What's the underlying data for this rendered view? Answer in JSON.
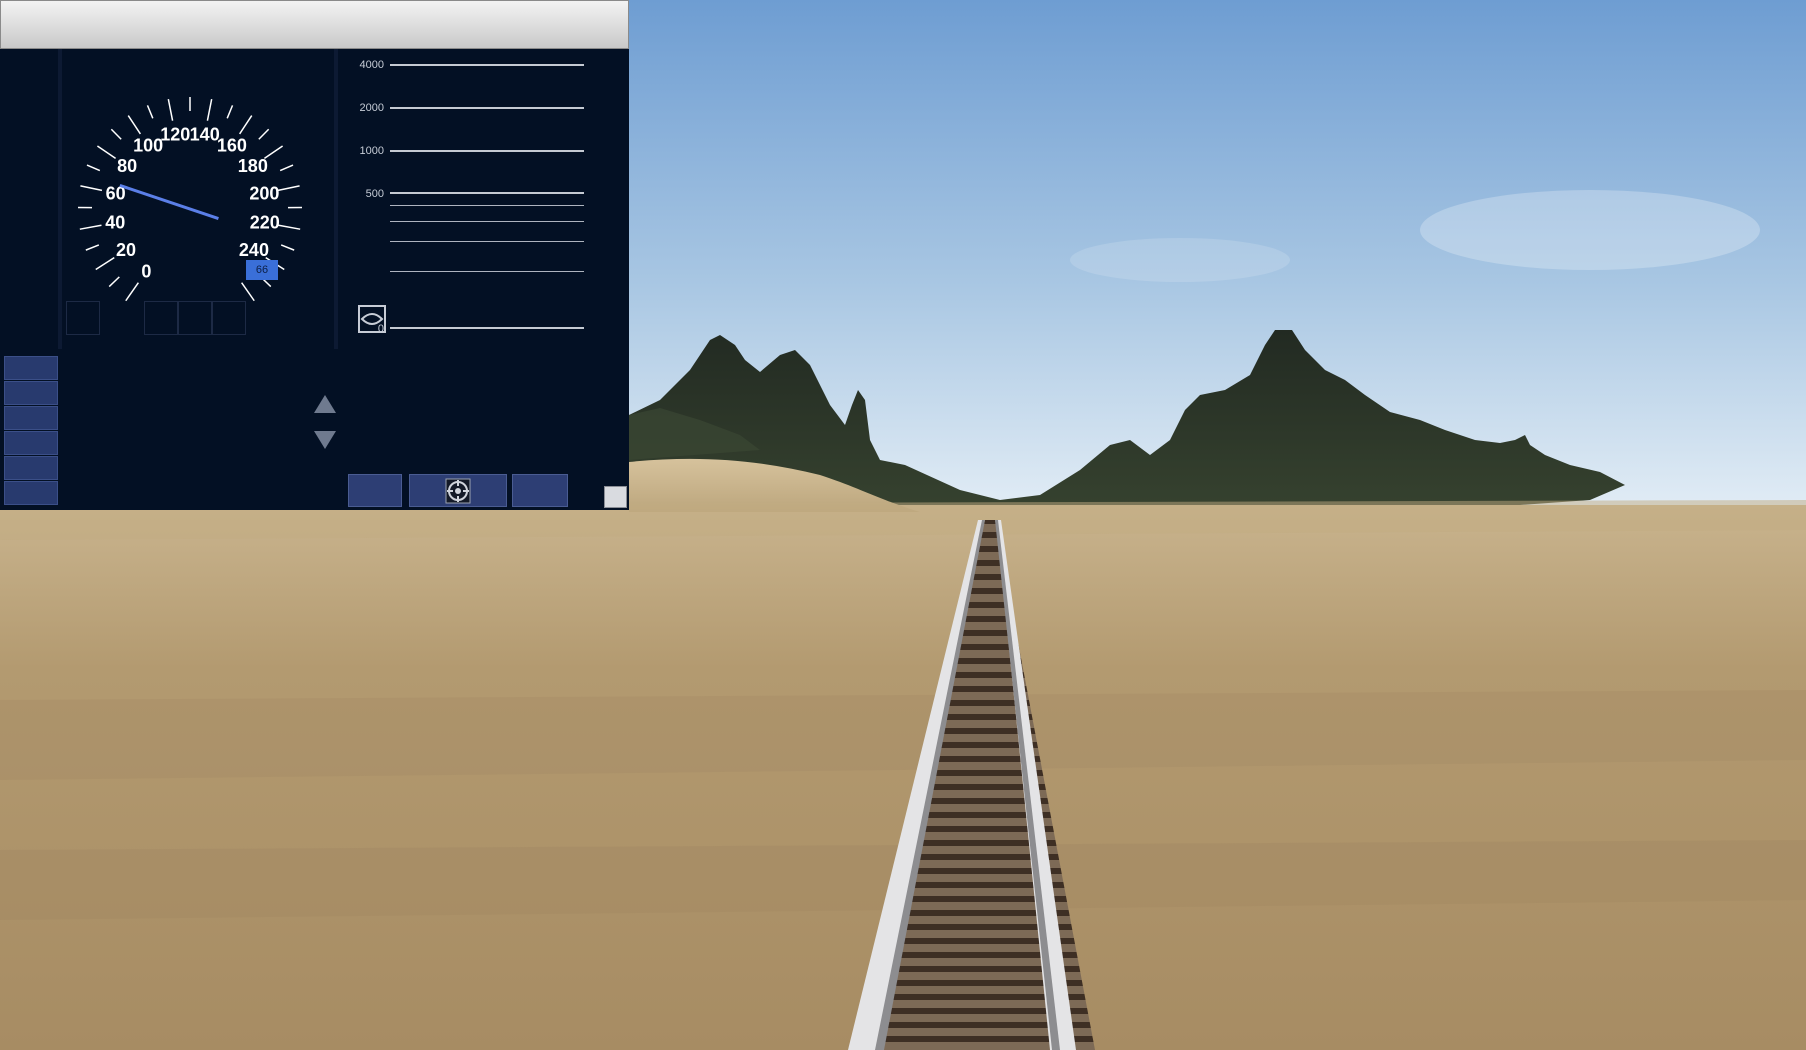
{
  "speedometer": {
    "scale_labels": [
      "0",
      "20",
      "40",
      "60",
      "80",
      "100",
      "120",
      "140",
      "160",
      "180",
      "200",
      "220",
      "240"
    ],
    "current_speed": 66,
    "digital_readout": "66",
    "needle_color": "#5b7fe8"
  },
  "distance_scale": {
    "labels": [
      "4000",
      "2000",
      "1000",
      "500",
      "0"
    ]
  },
  "icons": {
    "eye_button": "eye-icon",
    "bottom_center": "crosshair-icon",
    "up": "arrow-up-icon",
    "down": "arrow-down-icon"
  },
  "colors": {
    "panel_bg": "#031024",
    "button": "#2d3e74",
    "sky_top": "#6f9fd4",
    "sky_horizon": "#dce9f4",
    "ground": "#b69d74",
    "mountains": "#2a3427"
  }
}
